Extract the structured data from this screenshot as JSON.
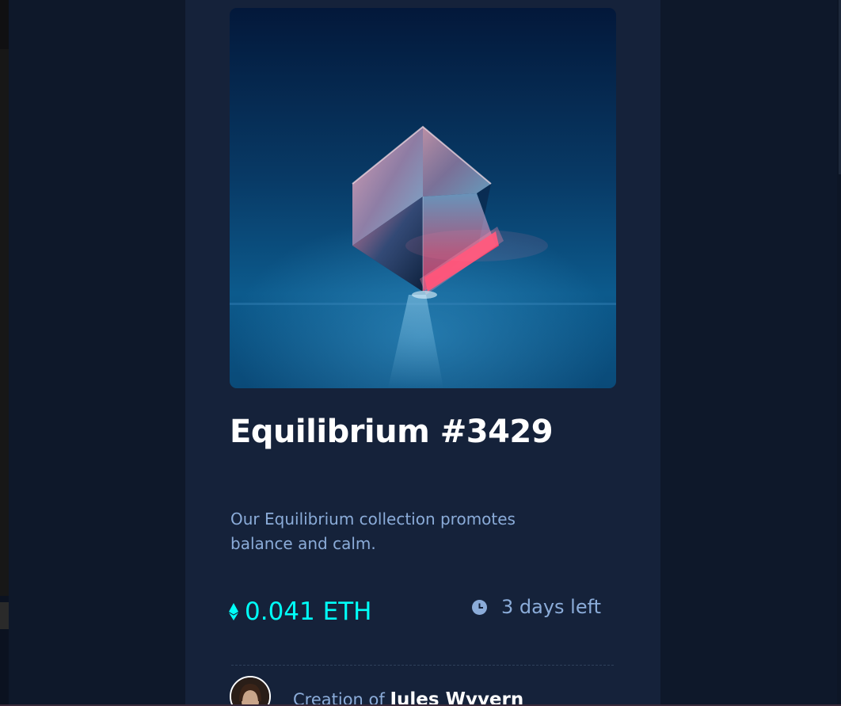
{
  "nft": {
    "title": "Equilibrium #3429",
    "description": "Our Equilibrium collection promotes balance and calm.",
    "price": "0.041 ETH",
    "time_left": "3 days left",
    "creator_prefix": "Creation of",
    "creator_name": "Jules Wyvern"
  },
  "icons": {
    "price": "ethereum-icon",
    "time": "clock-icon"
  },
  "colors": {
    "page_background": "#0e182a",
    "card_background": "#15223a",
    "title": "#ffffff",
    "description": "#8bacd9",
    "price_accent": "#00fff8",
    "divider": "#2e405a"
  }
}
